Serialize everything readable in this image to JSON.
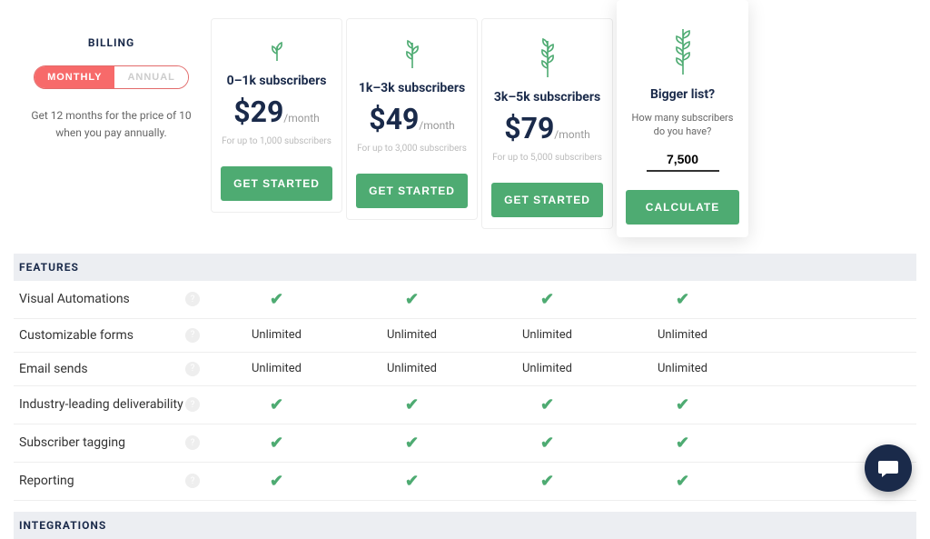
{
  "billing": {
    "heading": "BILLING",
    "monthly": "MONTHLY",
    "annual": "ANNUAL",
    "note": "Get 12 months for the price of 10 when you pay annually."
  },
  "plans": [
    {
      "title": "0–1k subscribers",
      "price": "$29",
      "per": "/month",
      "sub": "For up to 1,000 subscribers",
      "cta": "GET STARTED"
    },
    {
      "title": "1k–3k subscribers",
      "price": "$49",
      "per": "/month",
      "sub": "For up to 3,000 subscribers",
      "cta": "GET STARTED"
    },
    {
      "title": "3k–5k subscribers",
      "price": "$79",
      "per": "/month",
      "sub": "For up to 5,000 subscribers",
      "cta": "GET STARTED"
    }
  ],
  "calc": {
    "title": "Bigger list?",
    "question": "How many subscribers do you have?",
    "value": "7,500",
    "cta": "CALCULATE"
  },
  "sections": {
    "features": "FEATURES",
    "integrations": "INTEGRATIONS"
  },
  "features": [
    {
      "label": "Visual Automations",
      "cells": [
        "check",
        "check",
        "check",
        "check"
      ]
    },
    {
      "label": "Customizable forms",
      "cells": [
        "Unlimited",
        "Unlimited",
        "Unlimited",
        "Unlimited"
      ]
    },
    {
      "label": "Email sends",
      "cells": [
        "Unlimited",
        "Unlimited",
        "Unlimited",
        "Unlimited"
      ]
    },
    {
      "label": "Industry-leading deliverability",
      "cells": [
        "check",
        "check",
        "check",
        "check"
      ]
    },
    {
      "label": "Subscriber tagging",
      "cells": [
        "check",
        "check",
        "check",
        "check"
      ]
    },
    {
      "label": "Reporting",
      "cells": [
        "check",
        "check",
        "check",
        "check"
      ]
    }
  ]
}
